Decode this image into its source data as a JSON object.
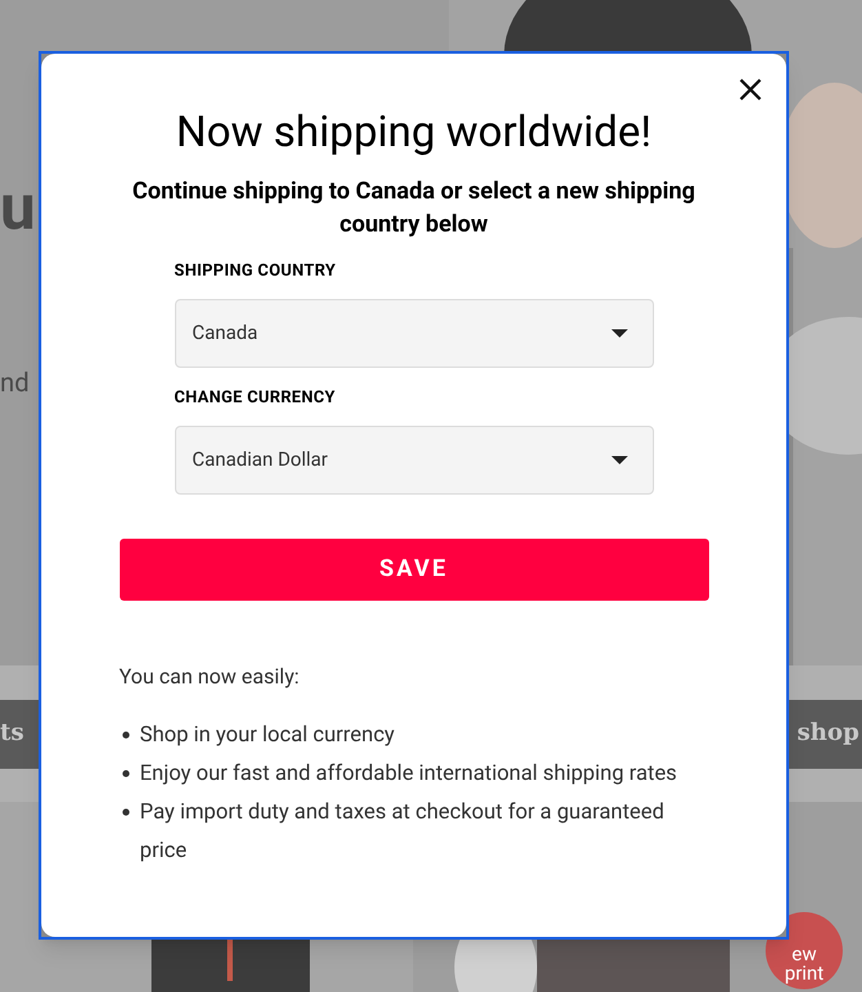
{
  "background": {
    "hero_fragments": [
      "u",
      "nd"
    ],
    "nav_fragments": [
      "ts",
      "shop"
    ],
    "badge": "ew print"
  },
  "modal": {
    "title": "Now shipping worldwide!",
    "subtitle": "Continue shipping to Canada or select a new shipping country below",
    "fields": [
      {
        "label": "SHIPPING COUNTRY",
        "value": "Canada"
      },
      {
        "label": "CHANGE CURRENCY",
        "value": "Canadian Dollar"
      }
    ],
    "save_button": "SAVE",
    "intro": "You can now easily:",
    "benefits": [
      "Shop in your local currency",
      "Enjoy our fast and affordable international shipping rates",
      "Pay import duty and taxes at checkout for a guaranteed price"
    ]
  }
}
